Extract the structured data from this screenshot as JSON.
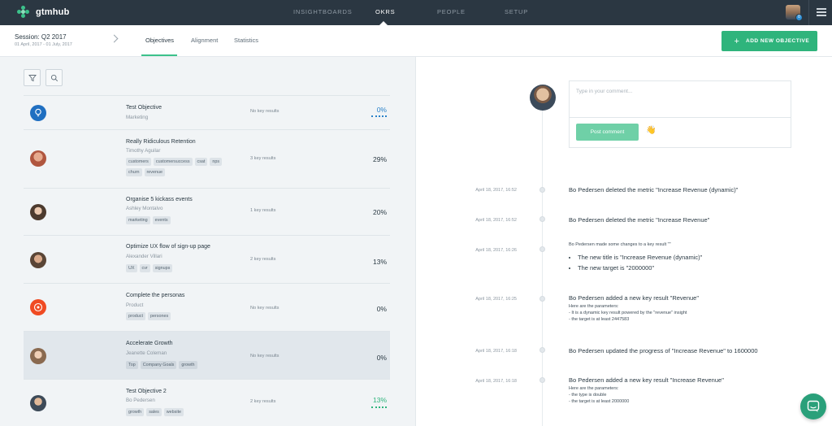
{
  "app": {
    "name": "gtmhub",
    "colors": {
      "nav_bg": "#2b3742",
      "accent": "#2fb47c",
      "link_blue": "#2a82c9"
    }
  },
  "nav": {
    "items": [
      "INSIGHTBOARDS",
      "OKRS",
      "PEOPLE",
      "SETUP"
    ],
    "active": "OKRS",
    "notifications_badge": "0"
  },
  "session": {
    "title": "Session: Q2 2017",
    "dates": "01 April, 2017 - 01 July, 2017"
  },
  "subtabs": [
    "Objectives",
    "Alignment",
    "Statistics"
  ],
  "actions": {
    "add_objective": "ADD NEW OBJECTIVE"
  },
  "toolbar": {
    "filter_icon": "filter-icon",
    "search_icon": "search-icon"
  },
  "objectives": [
    {
      "title": "Test Objective",
      "owner": "Marketing",
      "tags": [],
      "key_results": "No key results",
      "progress": "0%",
      "progress_style": "blue",
      "avatar": "lightbulb-icon"
    },
    {
      "title": "Really Ridiculous Retention",
      "owner": "Timothy Aguilar",
      "tags": [
        "customers",
        "customersuccess",
        "csat",
        "nps",
        "churn",
        "revenue"
      ],
      "key_results": "3 key results",
      "progress": "29%",
      "progress_style": "plain",
      "avatar": "person"
    },
    {
      "title": "Organise 5 kickass events",
      "owner": "Ashley Montalvo",
      "tags": [
        "marketing",
        "events"
      ],
      "key_results": "1 key results",
      "progress": "20%",
      "progress_style": "plain",
      "avatar": "person"
    },
    {
      "title": "Optimize UX flow of sign-up page",
      "owner": "Alexander Villari",
      "tags": [
        "UX",
        "cvr",
        "signups"
      ],
      "key_results": "2 key results",
      "progress": "13%",
      "progress_style": "plain",
      "avatar": "person"
    },
    {
      "title": "Complete the personas",
      "owner": "Product",
      "tags": [
        "product",
        "persones"
      ],
      "key_results": "No key results",
      "progress": "0%",
      "progress_style": "plain",
      "avatar": "team-icon"
    },
    {
      "title": "Accelerate Growth",
      "owner": "Jeanette Coleman",
      "tags": [
        "Top",
        "Company Goals",
        "growth"
      ],
      "key_results": "No key results",
      "progress": "0%",
      "progress_style": "plain",
      "avatar": "person",
      "selected": true
    },
    {
      "title": "Test Objective 2",
      "owner": "Bo Pedersen",
      "tags": [
        "growth",
        "sales",
        "website"
      ],
      "key_results": "2 key results",
      "progress": "13%",
      "progress_style": "green",
      "avatar": "person"
    }
  ],
  "comment": {
    "placeholder": "Type in your comment...",
    "post_label": "Post comment",
    "emoji_icon": "hand-emoji-icon"
  },
  "activity": [
    {
      "time": "April 18, 2017, 16:52",
      "text": "Bo Pedersen deleted the metric \"Increase Revenue (dynamic)\""
    },
    {
      "time": "April 18, 2017, 16:52",
      "text": "Bo Pedersen deleted the metric \"Increase Revenue\""
    },
    {
      "time": "April 18, 2017, 16:26",
      "heading": "Bo Pedersen made some changes to a key result \"\"",
      "bullets": [
        "The new title is \"Increase Revenue (dynamic)\"",
        "The new target is \"2000000\""
      ]
    },
    {
      "time": "April 18, 2017, 16:25",
      "text": "Bo Pedersen added a new key result \"Revenue\"",
      "details": [
        "Here are the parameters:",
        "- It is a dynamic key result powered by the \"revenue\" insight",
        "- the target is at least 2447583"
      ]
    },
    {
      "time": "April 18, 2017, 16:18",
      "text": "Bo Pedersen updated the progress of \"Increase Revenue\" to 1600000"
    },
    {
      "time": "April 18, 2017, 16:18",
      "text": "Bo Pedersen added a new key result \"Increase Revenue\"",
      "details": [
        "Here are the parameters:",
        "- the type is double",
        "- the target is at least 2000000"
      ]
    }
  ]
}
